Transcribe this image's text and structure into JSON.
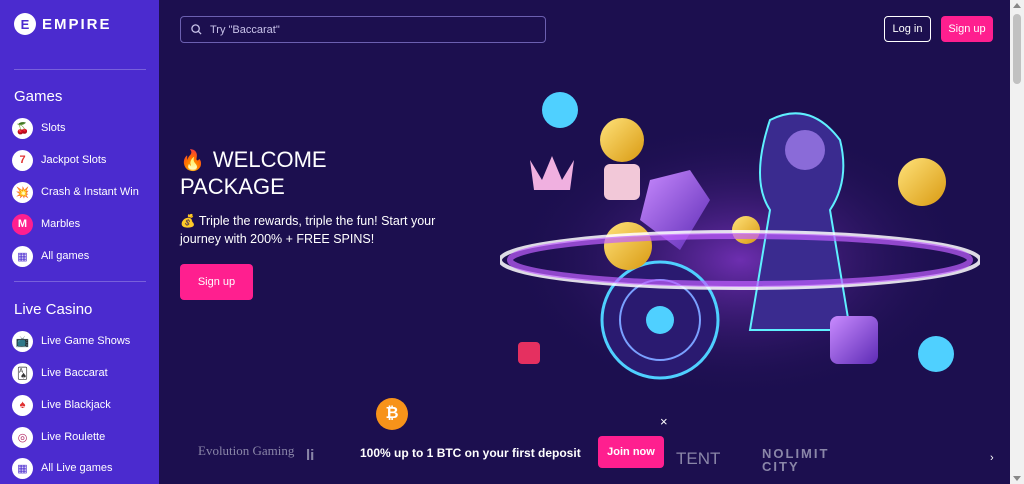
{
  "brand": {
    "logo_letter": "E",
    "name": "EMPIRE"
  },
  "sidebar": {
    "games_title": "Games",
    "games": [
      {
        "label": "Slots",
        "icon": "🍒"
      },
      {
        "label": "Jackpot Slots",
        "icon": "7"
      },
      {
        "label": "Crash & Instant Win",
        "icon": "💥"
      },
      {
        "label": "Marbles",
        "icon": "M"
      },
      {
        "label": "All games",
        "icon": "▦"
      }
    ],
    "live_title": "Live Casino",
    "live": [
      {
        "label": "Live Game Shows",
        "icon": "📺"
      },
      {
        "label": "Live Baccarat",
        "icon": "🂡"
      },
      {
        "label": "Live Blackjack",
        "icon": "♠"
      },
      {
        "label": "Live Roulette",
        "icon": "◎"
      },
      {
        "label": "All Live games",
        "icon": "▦"
      }
    ]
  },
  "header": {
    "search_placeholder": "Try \"Baccarat\"",
    "login_label": "Log in",
    "signup_label": "Sign up"
  },
  "hero": {
    "flame": "🔥",
    "title_line1": "WELCOME",
    "title_line2": "PACKAGE",
    "money_icon": "💰",
    "subtitle": "Triple the rewards, triple the fun! Start your journey with 200% + FREE SPINS!",
    "cta_label": "Sign up"
  },
  "promo": {
    "text": "100% up to 1 BTC on your first deposit",
    "join_label": "Join now",
    "close": "×",
    "btc_symbol": "₿"
  },
  "providers": [
    "Evolution Gaming",
    "li",
    "TENT",
    "NOLIMIT CITY"
  ],
  "next_arrow": "›",
  "colors": {
    "sidebar": "#4b2bcf",
    "background": "#1c0f4f",
    "accent": "#ff1f8f"
  }
}
